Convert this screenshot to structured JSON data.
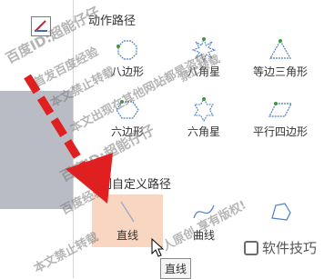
{
  "menu": {
    "section_motion": "动作路径",
    "section_custom": "绘制自定义路径",
    "motion_items": [
      {
        "label": "八边形",
        "icon": "octagon-icon"
      },
      {
        "label": "八角星",
        "icon": "eight-point-star-icon"
      },
      {
        "label": "等边三角形",
        "icon": "triangle-icon"
      },
      {
        "label": "六边形",
        "icon": "hexagon-icon"
      },
      {
        "label": "六角星",
        "icon": "six-point-star-icon"
      },
      {
        "label": "平行四边形",
        "icon": "parallelogram-icon"
      }
    ],
    "custom_items": [
      {
        "label": "直线",
        "icon": "line-icon",
        "highlighted": true
      },
      {
        "label": "曲线",
        "icon": "curve-icon"
      },
      {
        "label": "",
        "icon": "freeform-icon"
      }
    ]
  },
  "tooltip": "直线",
  "brand": "软件技巧",
  "watermark": {
    "line1": "百度ID:超能仔仔",
    "line2": "百度经验",
    "line3": "首发百度经验",
    "line4": "本文禁止转载",
    "line5": "本文出现在其他网站都是盗转",
    "line6": "个人原创,享有版权!",
    "line7": "禁止转载"
  },
  "colors": {
    "highlight": "#f9d6c1",
    "arrow": "#e02020",
    "accent": "#4a7fc1"
  }
}
